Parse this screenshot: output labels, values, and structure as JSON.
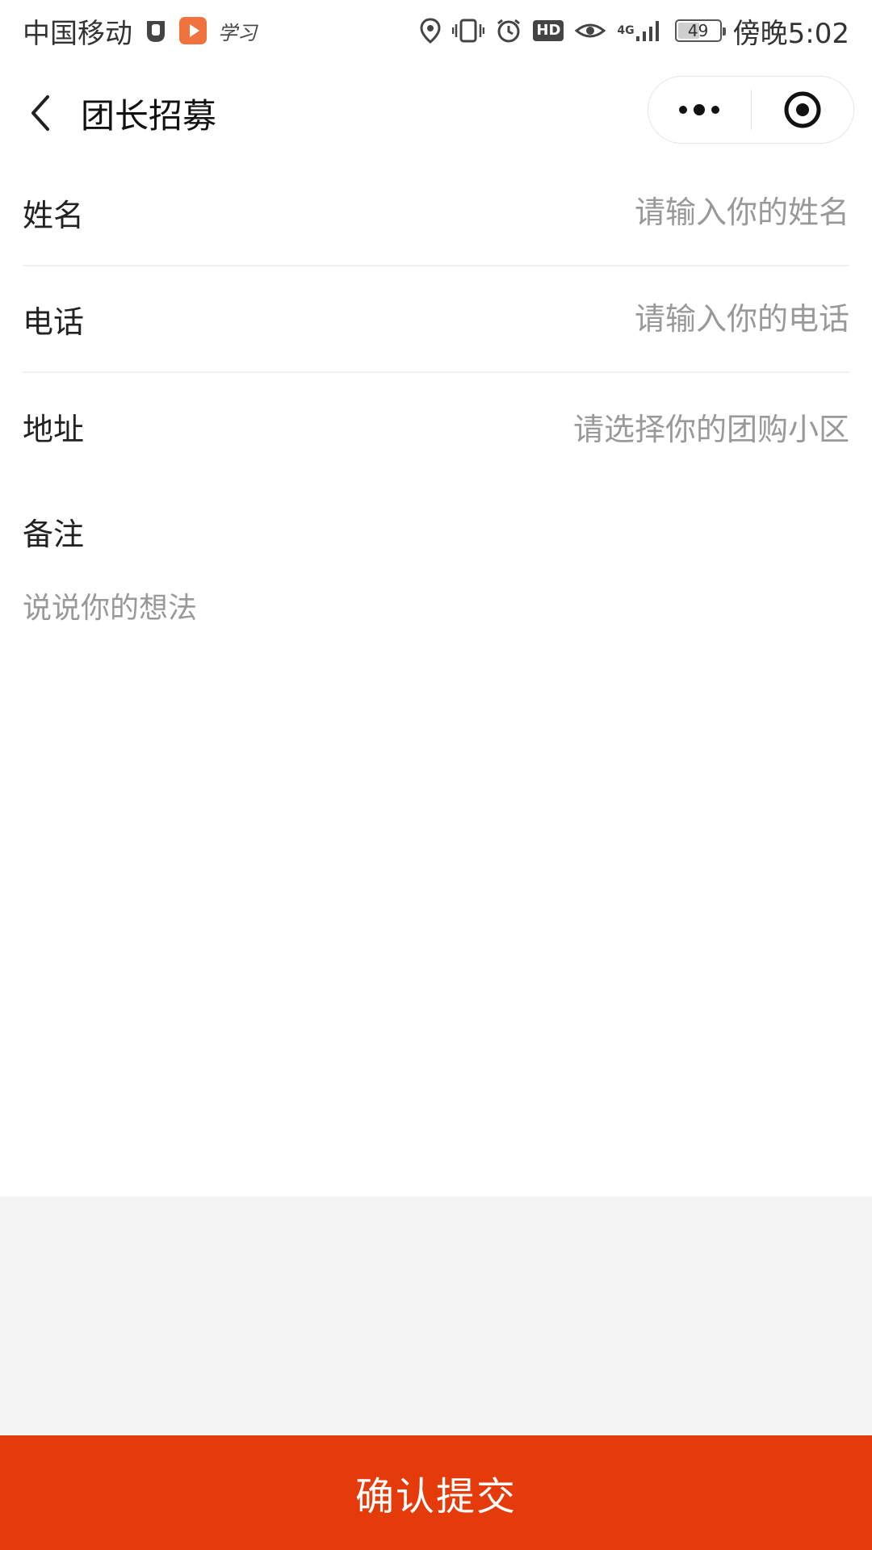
{
  "status_bar": {
    "carrier": "中国移动",
    "app_label": "学习",
    "network_type": "4G",
    "hd_label": "HD",
    "battery_level": "49",
    "time": "傍晚5:02",
    "icons": [
      "badge-icon",
      "video-app-icon",
      "location-icon",
      "vibrate-icon",
      "alarm-icon",
      "hd-icon",
      "eye-icon",
      "signal-icon",
      "battery-icon"
    ]
  },
  "nav": {
    "title": "团长招募",
    "icons": [
      "back-chevron-icon",
      "more-dots-icon",
      "target-close-icon"
    ]
  },
  "form": {
    "name": {
      "label": "姓名",
      "placeholder": "请输入你的姓名"
    },
    "phone": {
      "label": "电话",
      "placeholder": "请输入你的电话"
    },
    "address": {
      "label": "地址",
      "placeholder": "请选择你的团购小区"
    },
    "notes": {
      "label": "备注",
      "placeholder": "说说你的想法"
    }
  },
  "submit": {
    "label": "确认提交"
  },
  "colors": {
    "accent": "#e53a0a",
    "placeholder": "#999999",
    "divider": "#f0f0f0",
    "footer_background": "#f4f4f4"
  }
}
